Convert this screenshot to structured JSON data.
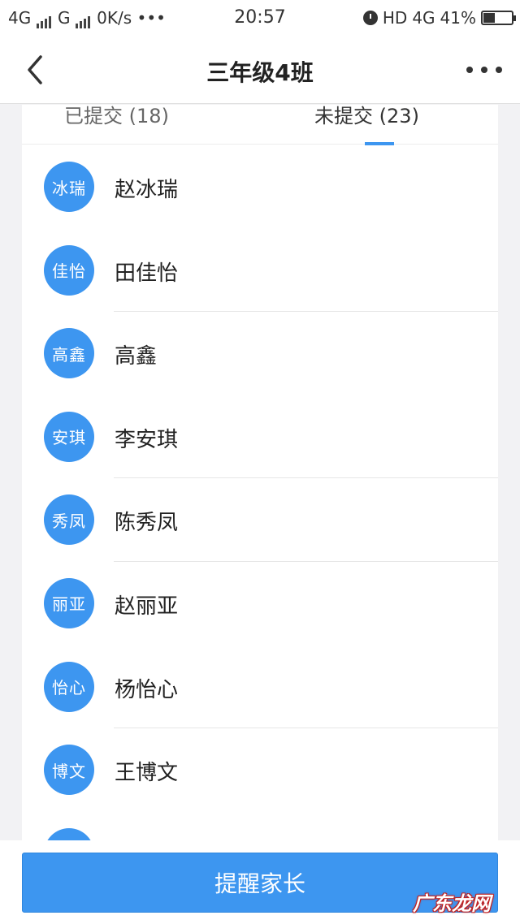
{
  "status_bar": {
    "left_text": "4G",
    "left_text_2": "G",
    "speed": "0K/s",
    "dots": "•••",
    "time": "20:57",
    "hd": "HD",
    "net": "4G",
    "battery": "41%"
  },
  "nav": {
    "title": "三年级4班"
  },
  "tabs": {
    "submitted": "已提交 (18)",
    "not_submitted": "未提交 (23)",
    "active": "not_submitted"
  },
  "students": [
    {
      "avatar": "冰瑞",
      "name": "赵冰瑞"
    },
    {
      "avatar": "佳怡",
      "name": "田佳怡"
    },
    {
      "avatar": "高鑫",
      "name": "高鑫"
    },
    {
      "avatar": "安琪",
      "name": "李安琪"
    },
    {
      "avatar": "秀凤",
      "name": "陈秀凤"
    },
    {
      "avatar": "丽亚",
      "name": "赵丽亚"
    },
    {
      "avatar": "怡心",
      "name": "杨怡心"
    },
    {
      "avatar": "博文",
      "name": "王博文"
    },
    {
      "avatar": "",
      "name": ""
    }
  ],
  "bottom": {
    "remind_label": "提醒家长"
  },
  "watermark": "广东龙网",
  "colors": {
    "accent": "#3d96f0",
    "background": "#f2f2f4"
  }
}
